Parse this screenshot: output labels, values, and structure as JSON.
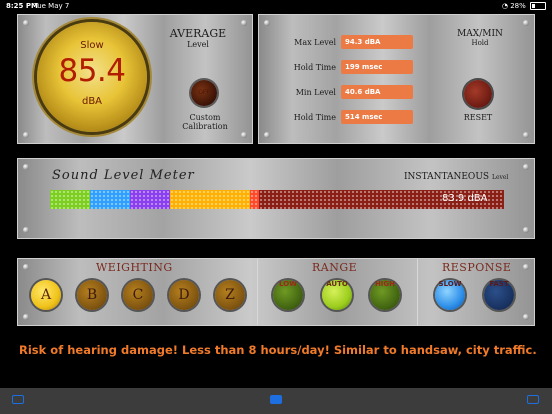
{
  "status_bar": {
    "time": "8:25 PM",
    "date": "Tue May 7",
    "battery": "28%"
  },
  "gauge": {
    "mode": "Slow",
    "value": "85.4",
    "unit": "dBA"
  },
  "average": {
    "title": "AVERAGE",
    "subtitle": "Level"
  },
  "calibration": {
    "button_text": "OFF",
    "label": "Custom Calibration"
  },
  "stats": [
    {
      "label": "Max Level",
      "value": "94.3 dBA"
    },
    {
      "label": "Hold Time",
      "value": "199 msec"
    },
    {
      "label": "Min Level",
      "value": "40.6 dBA"
    },
    {
      "label": "Hold Time",
      "value": "514 msec"
    }
  ],
  "maxmin": {
    "title": "MAX/MIN",
    "subtitle": "Hold",
    "reset_label": "RESET"
  },
  "meter": {
    "title": "Sound Level Meter",
    "inst_title": "INSTANTANEOUS",
    "inst_sub": "Level",
    "reading": "83.9 dBA",
    "level_fraction": 0.46
  },
  "weighting": {
    "title": "WEIGHTING",
    "options": [
      "A",
      "B",
      "C",
      "D",
      "Z"
    ],
    "selected": "A"
  },
  "range": {
    "title": "RANGE",
    "options": [
      "LOW",
      "AUTO",
      "HIGH"
    ],
    "selected": "AUTO"
  },
  "response": {
    "title": "RESPONSE",
    "options": [
      "SLOW",
      "FAST"
    ],
    "selected": "SLOW"
  },
  "warning": "Risk of hearing damage! Less than 8 hours/day! Similar to handsaw, city traffic.",
  "colors": {
    "accent": "#eb7a45",
    "warning": "#f07a2a",
    "segments": [
      "#7ccf20",
      "#2fa0ff",
      "#8a3ff0",
      "#ffb000",
      "#ff4a2a",
      "#8a1e14"
    ]
  },
  "icons": [
    "wifi-icon",
    "battery-icon",
    "camera-icon",
    "share-icon",
    "info-icon"
  ]
}
